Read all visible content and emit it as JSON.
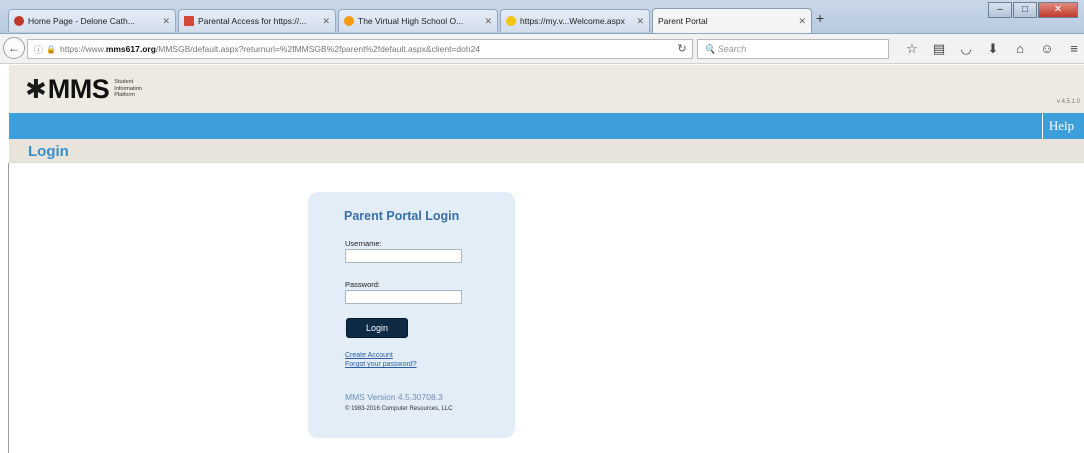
{
  "browser": {
    "tabs": [
      {
        "title": "Home Page - Delone Cath...",
        "icon_color": "#c0392b"
      },
      {
        "title": "Parental Access for https://...",
        "icon_color": "#d44638"
      },
      {
        "title": "The Virtual High School O...",
        "icon_color": "#f39c12"
      },
      {
        "title": "https://my.v...Welcome.aspx",
        "icon_color": "#f1c40f"
      },
      {
        "title": "Parent Portal",
        "icon_color": "#ffffff"
      }
    ],
    "new_tab_symbol": "+",
    "url": {
      "prefix": "https://www.",
      "domain": "mms617.org",
      "path": "/MMSGB/default.aspx?returnurl=%2fMMSGB%2fparent%2fdefault.aspx&client=doh24"
    },
    "search_placeholder": "Search",
    "toolbar_icons": [
      "star-icon",
      "reading-list-icon",
      "pocket-icon",
      "download-icon",
      "home-icon",
      "chat-icon",
      "menu-icon"
    ]
  },
  "site": {
    "logo_word": "MMS",
    "logo_tagline": [
      "Student",
      "Information",
      "Platform"
    ],
    "version_small": "v 4.5.1.0",
    "help_label": "Help",
    "page_title": "Login"
  },
  "login": {
    "title": "Parent Portal Login",
    "username_label": "Username:",
    "username_value": "",
    "password_label": "Password:",
    "password_value": "",
    "button_label": "Login",
    "create_account": "Create Account",
    "forgot_password": "Forgot your password?",
    "version": "MMS Version 4.5.30708.3",
    "copyright": "© 1983-2016 Computer Resources, LLC"
  },
  "colors": {
    "accent_blue": "#3c9fd9",
    "header_beige": "#eeeae2",
    "card_bg": "#e3edf7",
    "login_button": "#0e2a45",
    "title_blue": "#3a8fc9"
  }
}
